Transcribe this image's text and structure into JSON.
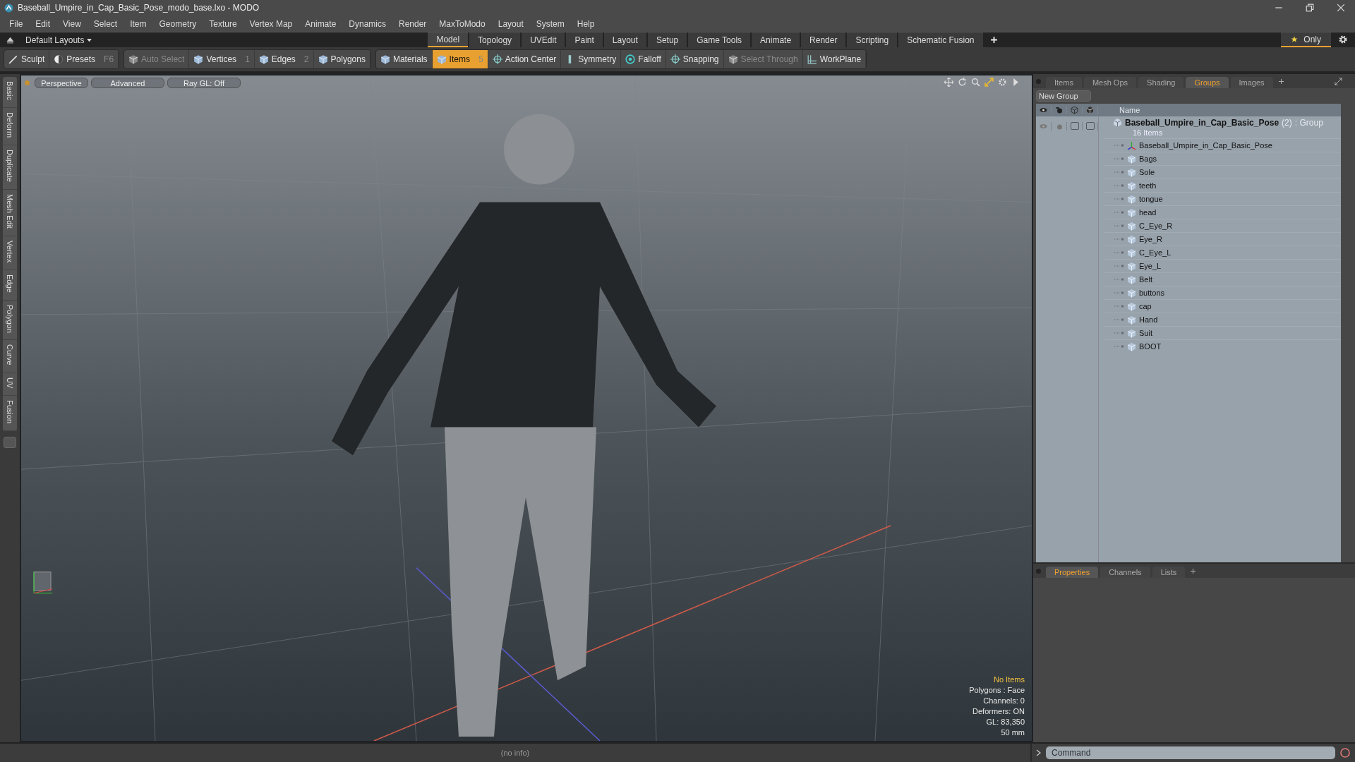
{
  "window": {
    "title": "Baseball_Umpire_in_Cap_Basic_Pose_modo_base.lxo - MODO"
  },
  "menu": [
    "File",
    "Edit",
    "View",
    "Select",
    "Item",
    "Geometry",
    "Texture",
    "Vertex Map",
    "Animate",
    "Dynamics",
    "Render",
    "MaxToModo",
    "Layout",
    "System",
    "Help"
  ],
  "layouts": {
    "label": "Default Layouts"
  },
  "layout_tabs": [
    {
      "label": "Model",
      "selected": true
    },
    {
      "label": "Topology",
      "selected": false
    },
    {
      "label": "UVEdit",
      "selected": false
    },
    {
      "label": "Paint",
      "selected": false
    },
    {
      "label": "Layout",
      "selected": false
    },
    {
      "label": "Setup",
      "selected": false
    },
    {
      "label": "Game Tools",
      "selected": false
    },
    {
      "label": "Animate",
      "selected": false
    },
    {
      "label": "Render",
      "selected": false
    },
    {
      "label": "Scripting",
      "selected": false
    },
    {
      "label": "Schematic Fusion",
      "selected": false
    }
  ],
  "only_button": {
    "label": "Only"
  },
  "toolbar_groups": [
    [
      {
        "label": "Sculpt",
        "kind": "brush",
        "selected": false,
        "disabled": false
      },
      {
        "label": "Presets",
        "shortcut": "F6",
        "kind": "ball",
        "selected": false,
        "disabled": false
      }
    ],
    [
      {
        "label": "Auto Select",
        "kind": "cube",
        "selected": false,
        "disabled": true
      },
      {
        "label": "Vertices",
        "shortcut": "1",
        "kind": "cube",
        "selected": false,
        "disabled": false
      },
      {
        "label": "Edges",
        "shortcut": "2",
        "kind": "cube",
        "selected": false,
        "disabled": false
      },
      {
        "label": "Polygons",
        "kind": "cube",
        "selected": false,
        "disabled": false
      }
    ],
    [
      {
        "label": "Materials",
        "kind": "cube",
        "selected": false,
        "disabled": false
      },
      {
        "label": "Items",
        "shortcut": "5",
        "kind": "cube",
        "selected": true,
        "disabled": false
      },
      {
        "label": "Action Center",
        "kind": "crosshair",
        "selected": false,
        "disabled": false
      },
      {
        "label": "Symmetry",
        "kind": "bar",
        "selected": false,
        "disabled": false
      },
      {
        "label": "Falloff",
        "kind": "ring",
        "selected": false,
        "disabled": false
      },
      {
        "label": "Snapping",
        "kind": "crosshair",
        "selected": false,
        "disabled": false
      },
      {
        "label": "Select Through",
        "kind": "cube",
        "selected": false,
        "disabled": true
      },
      {
        "label": "WorkPlane",
        "kind": "grid",
        "selected": false,
        "disabled": false
      }
    ]
  ],
  "side_tabs": [
    "Basic",
    "Deform",
    "Duplicate",
    "Mesh Edit",
    "Vertex",
    "Edge",
    "Polygon",
    "Curve",
    "UV",
    "Fusion"
  ],
  "viewport": {
    "buttons": [
      "Perspective",
      "Advanced",
      "Ray GL: Off"
    ],
    "info": [
      {
        "text": "No Items",
        "kind": "warning"
      },
      {
        "text": "Polygons : Face",
        "kind": "normal"
      },
      {
        "text": "Channels: 0",
        "kind": "normal"
      },
      {
        "text": "Deformers: ON",
        "kind": "normal"
      },
      {
        "text": "GL: 83,350",
        "kind": "normal"
      },
      {
        "text": "50 mm",
        "kind": "normal"
      }
    ]
  },
  "panel_tabs": [
    {
      "label": "Items",
      "selected": false
    },
    {
      "label": "Mesh Ops",
      "selected": false
    },
    {
      "label": "Shading",
      "selected": false
    },
    {
      "label": "Groups",
      "selected": true
    },
    {
      "label": "Images",
      "selected": false
    }
  ],
  "new_group_button": "New Group",
  "table": {
    "columns": [
      "Name"
    ],
    "group": {
      "name": "Baseball_Umpire_in_Cap_Basic_Pose",
      "count": "(2)",
      "type": ": Group",
      "subtitle": "16 Items",
      "locked": false,
      "select_locked": false,
      "children": [
        {
          "name": "Baseball_Umpire_in_Cap_Basic_Pose",
          "kind": "locator"
        },
        {
          "name": "Bags",
          "kind": "mesh"
        },
        {
          "name": "Sole",
          "kind": "mesh"
        },
        {
          "name": "teeth",
          "kind": "mesh"
        },
        {
          "name": "tongue",
          "kind": "mesh"
        },
        {
          "name": "head",
          "kind": "mesh"
        },
        {
          "name": "C_Eye_R",
          "kind": "mesh"
        },
        {
          "name": "Eye_R",
          "kind": "mesh"
        },
        {
          "name": "C_Eye_L",
          "kind": "mesh"
        },
        {
          "name": "Eye_L",
          "kind": "mesh"
        },
        {
          "name": "Belt",
          "kind": "mesh"
        },
        {
          "name": "buttons",
          "kind": "mesh"
        },
        {
          "name": "cap",
          "kind": "mesh"
        },
        {
          "name": "Hand",
          "kind": "mesh"
        },
        {
          "name": "Suit",
          "kind": "mesh"
        },
        {
          "name": "BOOT",
          "kind": "mesh"
        }
      ]
    }
  },
  "props_tabs": [
    {
      "label": "Properties",
      "selected": true
    },
    {
      "label": "Channels",
      "selected": false
    },
    {
      "label": "Lists",
      "selected": false
    }
  ],
  "command": {
    "placeholder": "Command"
  },
  "status_bar": "(no info)"
}
